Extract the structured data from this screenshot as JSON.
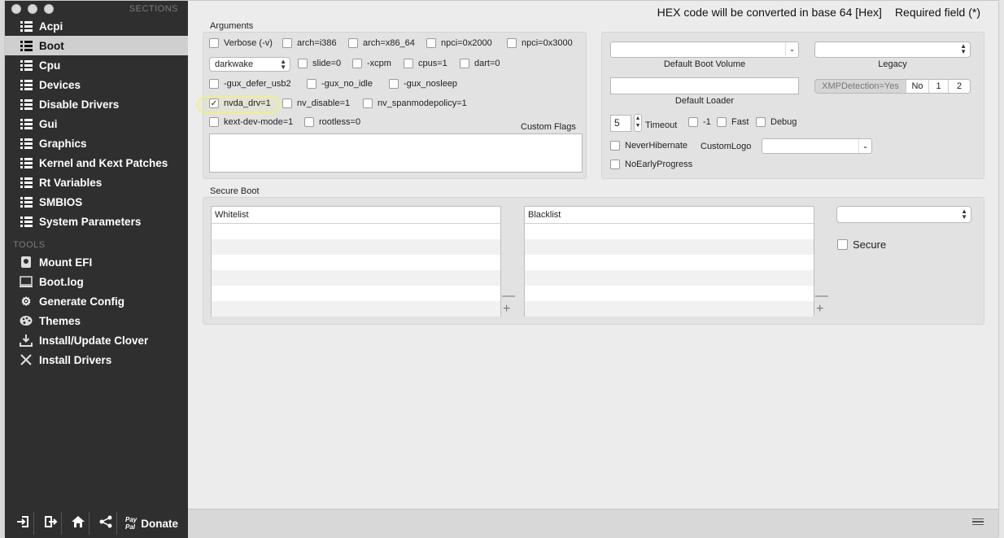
{
  "header": {
    "hex_note": "HEX code will be converted in base 64 [Hex]",
    "required_note": "Required field (*)"
  },
  "sidebar": {
    "sections_label": "SECTIONS",
    "tools_label": "TOOLS",
    "sections": [
      {
        "label": "Acpi",
        "icon": "list-icon"
      },
      {
        "label": "Boot",
        "icon": "list-icon",
        "selected": true
      },
      {
        "label": "Cpu",
        "icon": "list-icon"
      },
      {
        "label": "Devices",
        "icon": "list-icon"
      },
      {
        "label": "Disable Drivers",
        "icon": "list-icon"
      },
      {
        "label": "Gui",
        "icon": "list-icon"
      },
      {
        "label": "Graphics",
        "icon": "list-icon"
      },
      {
        "label": "Kernel and Kext Patches",
        "icon": "list-icon"
      },
      {
        "label": "Rt Variables",
        "icon": "list-icon"
      },
      {
        "label": "SMBIOS",
        "icon": "list-icon"
      },
      {
        "label": "System Parameters",
        "icon": "list-icon"
      }
    ],
    "tools": [
      {
        "label": "Mount EFI",
        "icon": "disk-icon"
      },
      {
        "label": "Boot.log",
        "icon": "log-icon"
      },
      {
        "label": "Generate Config",
        "icon": "gears-icon"
      },
      {
        "label": "Themes",
        "icon": "palette-icon"
      },
      {
        "label": "Install/Update Clover",
        "icon": "download-icon"
      },
      {
        "label": "Install Drivers",
        "icon": "tools-icon"
      }
    ],
    "bottom": {
      "paypal_line1": "Pay",
      "paypal_line2": "Pal",
      "donate_label": "Donate"
    }
  },
  "arguments": {
    "title": "Arguments",
    "verbose": "Verbose (-v)",
    "arch_i386": "arch=i386",
    "arch_x86_64": "arch=x86_64",
    "npci_2000": "npci=0x2000",
    "npci_3000": "npci=0x3000",
    "darkwake_select": "darkwake",
    "slide": "slide=0",
    "xcpm": "-xcpm",
    "cpus": "cpus=1",
    "dart": "dart=0",
    "gux_defer": "-gux_defer_usb2",
    "gux_no_idle": "-gux_no_idle",
    "gux_nosleep": "-gux_nosleep",
    "nvda_drv": "nvda_drv=1",
    "nv_disable": "nv_disable=1",
    "nv_spanmode": "nv_spanmodepolicy=1",
    "kext_dev": "kext-dev-mode=1",
    "rootless": "rootless=0",
    "custom_flags_label": "Custom Flags",
    "custom_flags_value": ""
  },
  "boot_options": {
    "default_boot_volume_label": "Default Boot Volume",
    "default_boot_volume_value": "",
    "legacy_label": "Legacy",
    "legacy_value": "",
    "default_loader_label": "Default Loader",
    "default_loader_value": "",
    "xmp_label": "XMPDetection=Yes",
    "xmp_no": "No",
    "xmp_1": "1",
    "xmp_2": "2",
    "timeout_value": "5",
    "timeout_label": "Timeout",
    "minus_one": "-1",
    "fast": "Fast",
    "debug": "Debug",
    "never_hibernate": "NeverHibernate",
    "custom_logo_label": "CustomLogo",
    "custom_logo_value": "",
    "no_early_progress": "NoEarlyProgress"
  },
  "secure_boot": {
    "title": "Secure Boot",
    "whitelist_header": "Whitelist",
    "blacklist_header": "Blacklist",
    "policy_value": "",
    "secure_label": "Secure",
    "minus": "—",
    "plus": "+"
  },
  "colors": {
    "sidebar_bg": "#2f2f2f",
    "selected_bg": "#cfcfcf",
    "highlight": "#eef08c"
  }
}
